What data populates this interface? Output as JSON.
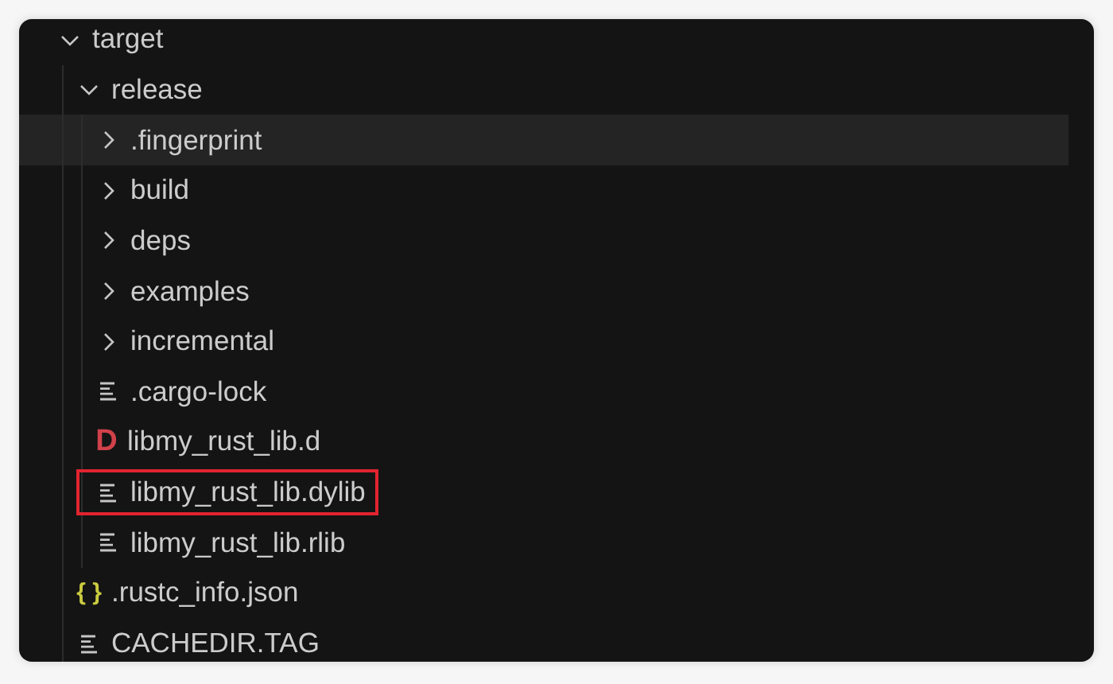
{
  "tree": [
    {
      "kind": "folder",
      "label": "target",
      "expanded": true,
      "hovered": false,
      "children": [
        {
          "kind": "folder",
          "label": "release",
          "expanded": true,
          "hovered": false,
          "children": [
            {
              "kind": "folder",
              "label": ".fingerprint",
              "expanded": false,
              "hovered": true
            },
            {
              "kind": "folder",
              "label": "build",
              "expanded": false,
              "hovered": false
            },
            {
              "kind": "folder",
              "label": "deps",
              "expanded": false,
              "hovered": false
            },
            {
              "kind": "folder",
              "label": "examples",
              "expanded": false,
              "hovered": false
            },
            {
              "kind": "folder",
              "label": "incremental",
              "expanded": false,
              "hovered": false
            },
            {
              "kind": "text-file",
              "label": ".cargo-lock",
              "hovered": false,
              "highlighted": false
            },
            {
              "kind": "d-file",
              "icon_text": "D",
              "label": "libmy_rust_lib.d",
              "hovered": false,
              "highlighted": false
            },
            {
              "kind": "text-file",
              "label": "libmy_rust_lib.dylib",
              "hovered": false,
              "highlighted": true
            },
            {
              "kind": "text-file",
              "label": "libmy_rust_lib.rlib",
              "hovered": false,
              "highlighted": false
            }
          ]
        },
        {
          "kind": "json-file",
          "icon_text": "{ }",
          "label": ".rustc_info.json",
          "hovered": false,
          "highlighted": false
        },
        {
          "kind": "text-file",
          "label": "CACHEDIR.TAG",
          "hovered": false,
          "highlighted": false
        }
      ]
    }
  ]
}
